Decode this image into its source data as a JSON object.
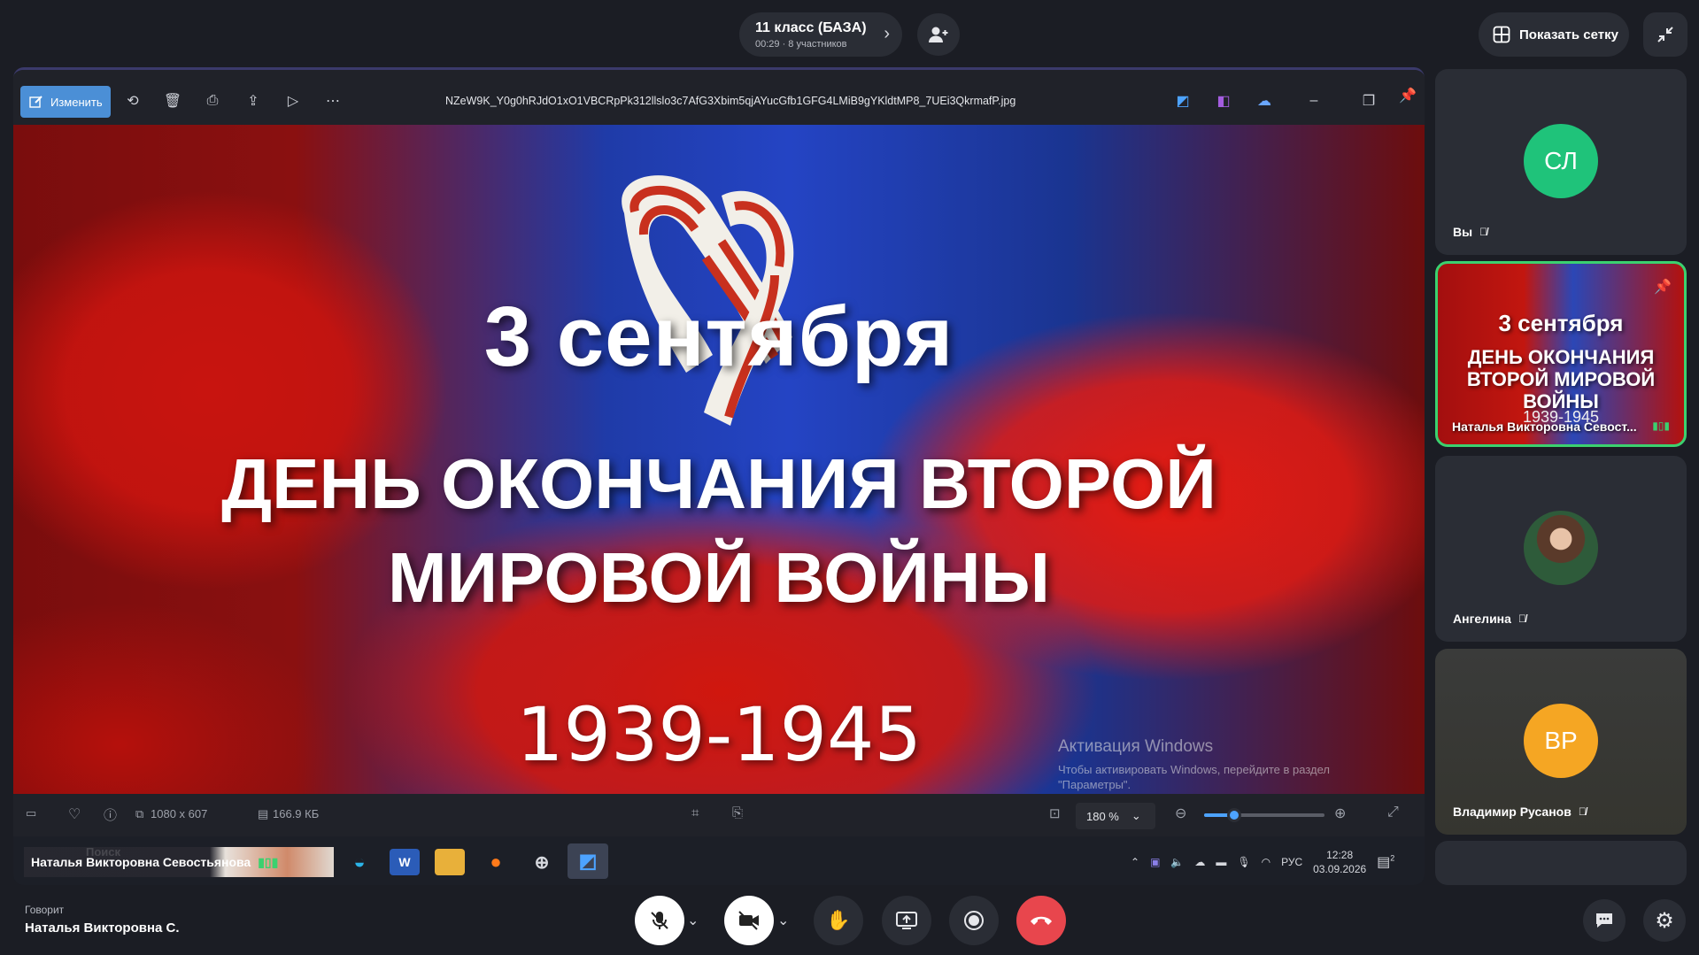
{
  "meeting": {
    "title": "11 класс (БАЗА)",
    "subtitle": "00:29 · 8 участников",
    "show_grid_label": "Показать сетку"
  },
  "viewer": {
    "edit_label": "Изменить",
    "filename": "NZeW9K_Y0g0hRJdO1xO1VBCRpPk312llslo3c7AfG3Xbim5qjAYucGfb1GFG4LMiB9gYKldtMP8_7UEi3QkrmafP.jpg",
    "dimensions": "1080 x 607",
    "file_size": "166.9 КБ",
    "zoom": "180 %",
    "zoom_level": 0.25
  },
  "slide": {
    "date": "3 сентября",
    "title_line1": "ДЕНЬ ОКОНЧАНИЯ ВТОРОЙ",
    "title_line2": "МИРОВОЙ ВОЙНЫ",
    "years": "1939-1945"
  },
  "activation": {
    "title": "Активация Windows",
    "line1": "Чтобы активировать Windows, перейдите в раздел",
    "line2": "\"Параметры\"."
  },
  "taskbar": {
    "presenter": "Наталья Викторовна Севостьянова",
    "search_placeholder": "Поиск",
    "lang": "РУС",
    "time": "12:28",
    "date": "03.09.2026",
    "notifications": "2"
  },
  "participants": [
    {
      "initials": "СЛ",
      "name": "Вы",
      "color": "#1fc37a"
    },
    {
      "name": "Наталья Викторовна Севост...",
      "slide_date": "3 сентября",
      "slide_title": "ДЕНЬ ОКОНЧАНИЯ ВТОРОЙ МИРОВОЙ ВОЙНЫ",
      "slide_years": "1939-1945"
    },
    {
      "name": "Ангелина"
    },
    {
      "initials": "ВР",
      "name": "Владимир Русанов",
      "color": "#f5a623"
    }
  ],
  "speaker": {
    "label": "Говорит",
    "name": "Наталья Викторовна С."
  },
  "colors": {
    "accent_green": "#3bd16f",
    "end_call_red": "#e8464d",
    "edit_blue": "#4b8fd6"
  }
}
